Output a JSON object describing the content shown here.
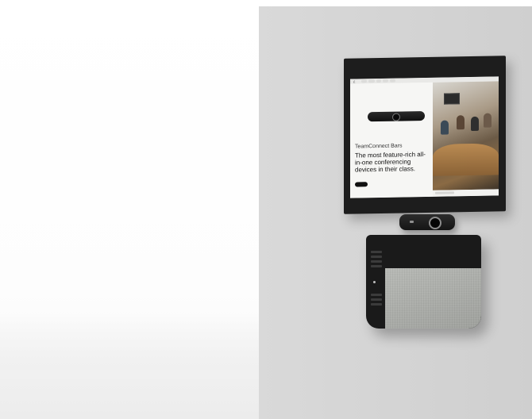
{
  "screen": {
    "product_name": "TeamConnect Bars",
    "headline": "The most feature-rich all-in-one conferencing devices in their class."
  }
}
